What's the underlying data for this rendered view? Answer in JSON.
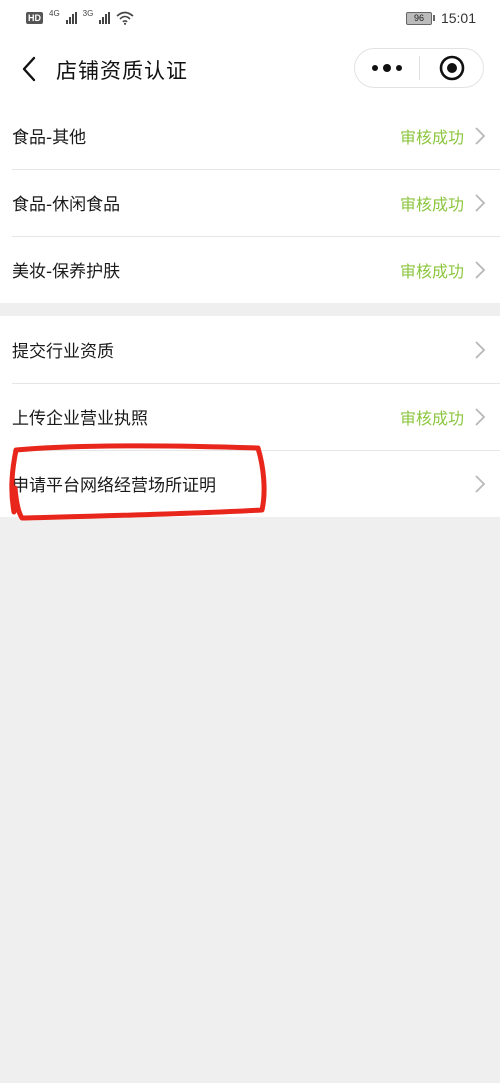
{
  "status_bar": {
    "hd": "HD",
    "net1": "4G",
    "net2": "3G",
    "battery": "96",
    "time": "15:01"
  },
  "header": {
    "title": "店铺资质认证",
    "back_icon": "chevron-left-icon",
    "more_icon": "more-dots-icon",
    "close_icon": "target-close-icon"
  },
  "section1": {
    "items": [
      {
        "label": "食品-其他",
        "status": "审核成功"
      },
      {
        "label": "食品-休闲食品",
        "status": "审核成功"
      },
      {
        "label": "美妆-保养护肤",
        "status": "审核成功"
      }
    ]
  },
  "section2": {
    "items": [
      {
        "label": "提交行业资质",
        "status": ""
      },
      {
        "label": "上传企业营业执照",
        "status": "审核成功"
      },
      {
        "label": "申请平台网络经营场所证明",
        "status": ""
      }
    ]
  },
  "colors": {
    "status_green": "#8cc63f",
    "annotation_red": "#e8261c",
    "background": "#efefef"
  }
}
